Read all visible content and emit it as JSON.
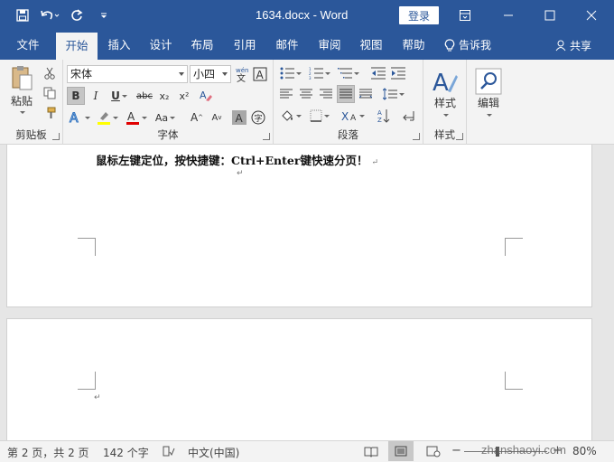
{
  "titlebar": {
    "doc_title": "1634.docx - Word",
    "login_label": "登录",
    "icons": [
      "save-icon",
      "undo-icon",
      "redo-icon",
      "customize-qat-icon",
      "ribbon-display-icon",
      "minimize-icon",
      "maximize-icon",
      "close-icon"
    ]
  },
  "tabs": [
    {
      "label": "文件"
    },
    {
      "label": "开始"
    },
    {
      "label": "插入"
    },
    {
      "label": "设计"
    },
    {
      "label": "布局"
    },
    {
      "label": "引用"
    },
    {
      "label": "邮件"
    },
    {
      "label": "审阅"
    },
    {
      "label": "视图"
    },
    {
      "label": "帮助"
    }
  ],
  "active_tab": "开始",
  "tellme_label": "告诉我",
  "share_label": "共享",
  "ribbon": {
    "clipboard": {
      "label": "剪贴板",
      "paste_label": "粘贴"
    },
    "font": {
      "label": "字体",
      "font_name": "宋体",
      "font_size": "小四",
      "font_color": "#e00000",
      "highlight_color": "#ffff00"
    },
    "paragraph": {
      "label": "段落"
    },
    "styles": {
      "label": "样式",
      "button_label": "样式"
    },
    "editing": {
      "label": "编辑",
      "button_label": "编辑"
    }
  },
  "document": {
    "line1_text": "鼠标左键定位，按快捷键：Ctrl+Enter键快速分页！",
    "paragraph_mark": "↵"
  },
  "status": {
    "page_info": "第 2 页，共 2 页",
    "word_count": "142 个字",
    "language": "中文(中国)",
    "zoom_level": "80%",
    "zoom_fraction": 0.4
  },
  "watermark": "zhanshaoyi.com",
  "colors": {
    "brand": "#2b579a",
    "ribbon_bg": "#f3f3f3"
  }
}
